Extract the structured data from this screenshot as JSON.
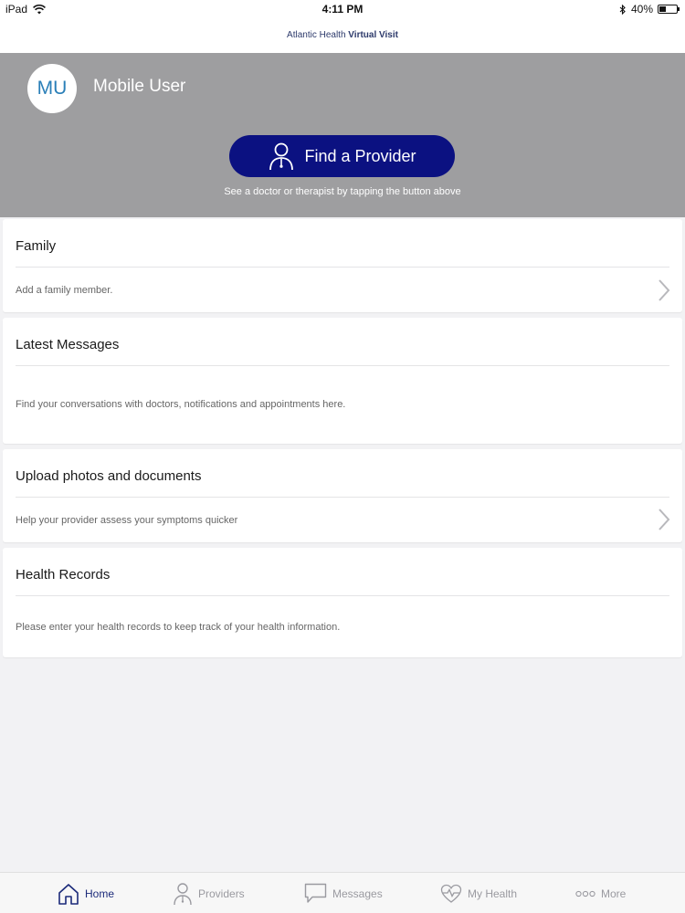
{
  "status_bar": {
    "device": "iPad",
    "time": "4:11 PM",
    "battery": "40%",
    "battery_level": 0.4
  },
  "header": {
    "brand_regular": "Atlantic Health",
    "brand_bold": "Virtual Visit"
  },
  "profile": {
    "initials": "MU",
    "name": "Mobile User"
  },
  "find_provider": {
    "label": "Find a Provider",
    "caption": "See a doctor or therapist by tapping the button above"
  },
  "cards": {
    "family": {
      "title": "Family",
      "description": "Add a family member."
    },
    "messages": {
      "title": "Latest Messages",
      "description": "Find your conversations with doctors, notifications and appointments here."
    },
    "upload": {
      "title": "Upload photos and documents",
      "description": "Help your provider assess your symptoms quicker"
    },
    "records": {
      "title": "Health Records",
      "description": "Please enter your health records to keep track of your health information."
    }
  },
  "tabs": {
    "home": "Home",
    "providers": "Providers",
    "messages": "Messages",
    "my_health": "My Health",
    "more": "More"
  },
  "colors": {
    "hero_bg": "#9e9ea0",
    "button_bg": "#0b1181",
    "avatar_text": "#2a7fb8",
    "active_tab": "#1b2a7a",
    "inactive_tab": "#9a9aa0"
  }
}
